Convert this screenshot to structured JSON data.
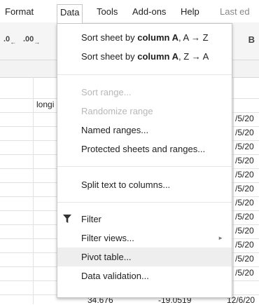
{
  "menubar": {
    "format": "Format",
    "data": "Data",
    "tools": "Tools",
    "addons": "Add-ons",
    "help": "Help",
    "last_edit": "Last ed"
  },
  "toolbar": {
    "decrease_decimal": ".0",
    "increase_decimal": ".00",
    "bold": "B"
  },
  "sheet": {
    "cell_text": "longi",
    "right_column": [
      "/5/20",
      "/5/20",
      "/5/20",
      "/5/20",
      "/5/20",
      "/5/20",
      "/5/20",
      "/5/20",
      "/5/20",
      "/5/20",
      "/5/20",
      "/5/20"
    ],
    "bottom_row": [
      "34.676",
      "-19.0519",
      "12/6/20"
    ]
  },
  "data_menu": {
    "sort_az": {
      "prefix": "Sort sheet by ",
      "col": "column A",
      "suffix": ", A → Z"
    },
    "sort_za": {
      "prefix": "Sort sheet by ",
      "col": "column A",
      "suffix": ", Z → A"
    },
    "sort_range": "Sort range...",
    "randomize_range": "Randomize range",
    "named_ranges": "Named ranges...",
    "protected": "Protected sheets and ranges...",
    "split_text": "Split text to columns...",
    "filter": "Filter",
    "filter_views": "Filter views...",
    "pivot_table": "Pivot table...",
    "data_validation": "Data validation..."
  }
}
